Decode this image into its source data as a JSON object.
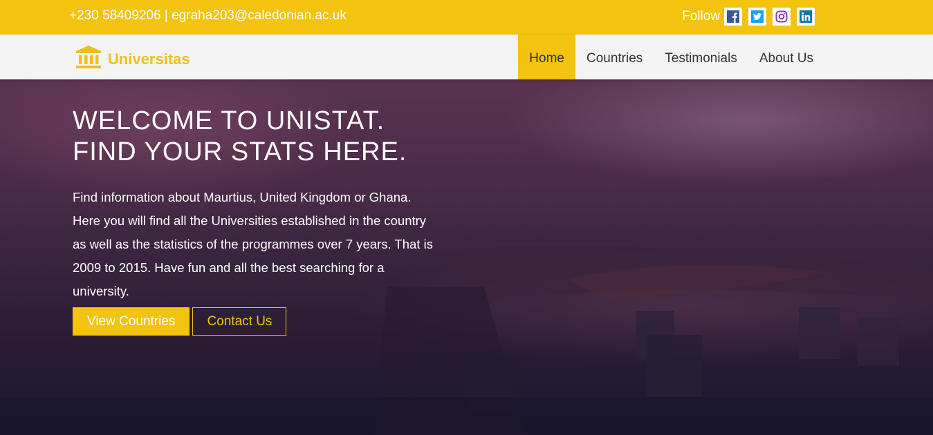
{
  "topbar": {
    "contact": "+230 58409206 | egraha203@caledonian.ac.uk",
    "follow_label": "Follow",
    "social": [
      {
        "icon": "facebook-icon",
        "color": "#3b5998"
      },
      {
        "icon": "twitter-icon",
        "color": "#1da1f2"
      },
      {
        "icon": "instagram-icon",
        "color": "#8a3ab9"
      },
      {
        "icon": "linkedin-icon",
        "color": "#0e76a8"
      }
    ]
  },
  "brand": {
    "name": "Universitas",
    "icon": "university-building-icon",
    "color": "#f0bf1a"
  },
  "nav": {
    "items": [
      {
        "label": "Home",
        "active": true
      },
      {
        "label": "Countries"
      },
      {
        "label": "Testimonials"
      },
      {
        "label": "About Us"
      }
    ]
  },
  "hero": {
    "headline_line1": "WELCOME TO UNISTAT.",
    "headline_line2": "FIND YOUR STATS HERE.",
    "intro": "Find information about Maurtius, United Kingdom or Ghana. Here you will find all the Universities established in the country as well as the statistics of the programmes over 7 years. That is 2009 to 2015. Have fun and all the best searching for a university.",
    "primary_button": "View Countries",
    "secondary_button": "Contact Us"
  },
  "colors": {
    "accent": "#f3c30f",
    "navbar_bg": "#f4f4f4"
  }
}
